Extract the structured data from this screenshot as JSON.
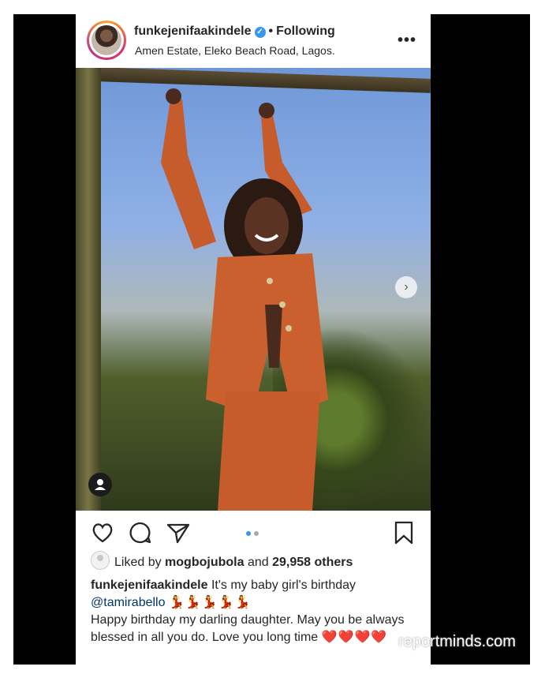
{
  "header": {
    "username": "funkejenifaakindele",
    "verified_icon": "verified-badge-icon",
    "separator": "•",
    "follow_status": "Following",
    "location": "Amen Estate, Eleko Beach Road, Lagos.",
    "more_icon": "•••"
  },
  "photo": {
    "next_icon": "›",
    "carousel_index": 1,
    "carousel_total": 2
  },
  "actions": {
    "like_icon": "heart-outline-icon",
    "comment_icon": "comment-bubble-icon",
    "share_icon": "paper-plane-icon",
    "save_icon": "bookmark-icon"
  },
  "likes": {
    "prefix": "Liked by",
    "first_user": "mogbojubola",
    "joiner": "and",
    "others": "29,958 others"
  },
  "caption": {
    "username": "funkejenifaakindele",
    "line1": " It's my baby girl's birthday",
    "mention": "@tamirabello",
    "dancer_emojis": "💃💃💃💃💃",
    "line2": "Happy birthday my darling daughter. May you be always blessed in all you do. Love you long time ",
    "hearts": "❤️❤️❤️❤️"
  },
  "watermark": "reportminds.com",
  "colors": {
    "link": "#003569",
    "accent_blue": "#3897f0",
    "text": "#262626"
  }
}
